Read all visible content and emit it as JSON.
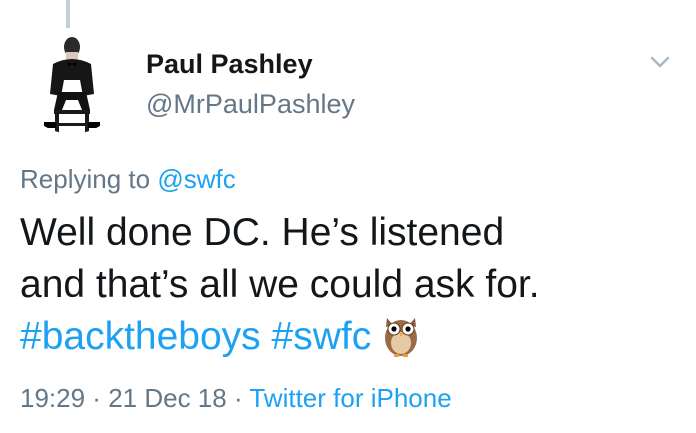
{
  "author": {
    "name": "Paul Pashley",
    "handle": "@MrPaulPashley"
  },
  "reply": {
    "prefix": "Replying to ",
    "mention": "@swfc"
  },
  "tweet": {
    "line1": "Well done DC. He’s listened",
    "line2": "and that’s all we could ask for.",
    "hashtag1": "#backtheboys",
    "hashtag2": "#swfc",
    "emoji": "owl"
  },
  "meta": {
    "time": "19:29",
    "separator1": " · ",
    "date": "21 Dec 18",
    "separator2": " · ",
    "source": "Twitter for iPhone"
  },
  "colors": {
    "link": "#1da1f2",
    "secondary": "#657786",
    "text": "#14171a"
  },
  "icons": {
    "menu": "chevron-down-icon",
    "emoji": "owl-emoji-icon"
  }
}
